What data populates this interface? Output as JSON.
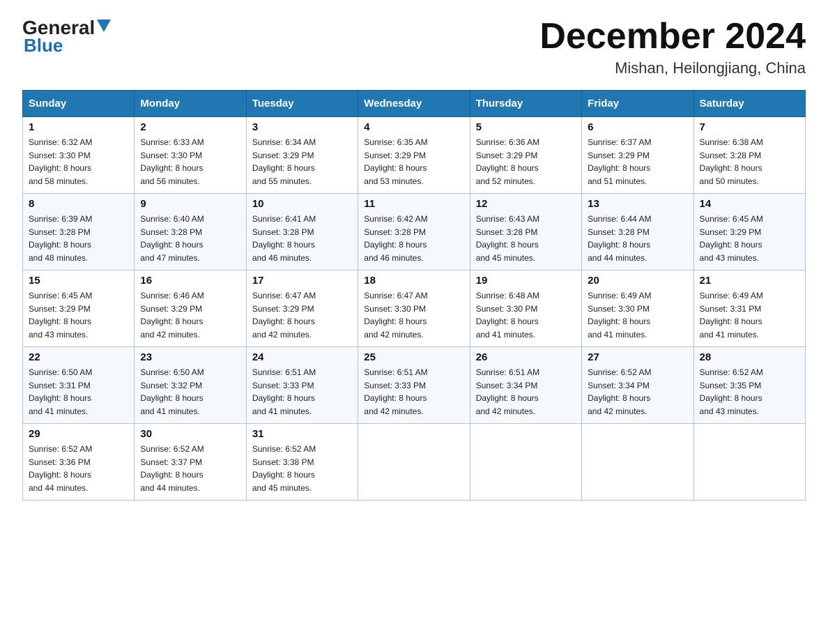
{
  "header": {
    "logo_general": "General",
    "logo_blue": "Blue",
    "month_title": "December 2024",
    "location": "Mishan, Heilongjiang, China"
  },
  "days_of_week": [
    "Sunday",
    "Monday",
    "Tuesday",
    "Wednesday",
    "Thursday",
    "Friday",
    "Saturday"
  ],
  "weeks": [
    [
      {
        "day": "1",
        "sunrise": "6:32 AM",
        "sunset": "3:30 PM",
        "daylight": "8 hours and 58 minutes."
      },
      {
        "day": "2",
        "sunrise": "6:33 AM",
        "sunset": "3:30 PM",
        "daylight": "8 hours and 56 minutes."
      },
      {
        "day": "3",
        "sunrise": "6:34 AM",
        "sunset": "3:29 PM",
        "daylight": "8 hours and 55 minutes."
      },
      {
        "day": "4",
        "sunrise": "6:35 AM",
        "sunset": "3:29 PM",
        "daylight": "8 hours and 53 minutes."
      },
      {
        "day": "5",
        "sunrise": "6:36 AM",
        "sunset": "3:29 PM",
        "daylight": "8 hours and 52 minutes."
      },
      {
        "day": "6",
        "sunrise": "6:37 AM",
        "sunset": "3:29 PM",
        "daylight": "8 hours and 51 minutes."
      },
      {
        "day": "7",
        "sunrise": "6:38 AM",
        "sunset": "3:28 PM",
        "daylight": "8 hours and 50 minutes."
      }
    ],
    [
      {
        "day": "8",
        "sunrise": "6:39 AM",
        "sunset": "3:28 PM",
        "daylight": "8 hours and 48 minutes."
      },
      {
        "day": "9",
        "sunrise": "6:40 AM",
        "sunset": "3:28 PM",
        "daylight": "8 hours and 47 minutes."
      },
      {
        "day": "10",
        "sunrise": "6:41 AM",
        "sunset": "3:28 PM",
        "daylight": "8 hours and 46 minutes."
      },
      {
        "day": "11",
        "sunrise": "6:42 AM",
        "sunset": "3:28 PM",
        "daylight": "8 hours and 46 minutes."
      },
      {
        "day": "12",
        "sunrise": "6:43 AM",
        "sunset": "3:28 PM",
        "daylight": "8 hours and 45 minutes."
      },
      {
        "day": "13",
        "sunrise": "6:44 AM",
        "sunset": "3:28 PM",
        "daylight": "8 hours and 44 minutes."
      },
      {
        "day": "14",
        "sunrise": "6:45 AM",
        "sunset": "3:29 PM",
        "daylight": "8 hours and 43 minutes."
      }
    ],
    [
      {
        "day": "15",
        "sunrise": "6:45 AM",
        "sunset": "3:29 PM",
        "daylight": "8 hours and 43 minutes."
      },
      {
        "day": "16",
        "sunrise": "6:46 AM",
        "sunset": "3:29 PM",
        "daylight": "8 hours and 42 minutes."
      },
      {
        "day": "17",
        "sunrise": "6:47 AM",
        "sunset": "3:29 PM",
        "daylight": "8 hours and 42 minutes."
      },
      {
        "day": "18",
        "sunrise": "6:47 AM",
        "sunset": "3:30 PM",
        "daylight": "8 hours and 42 minutes."
      },
      {
        "day": "19",
        "sunrise": "6:48 AM",
        "sunset": "3:30 PM",
        "daylight": "8 hours and 41 minutes."
      },
      {
        "day": "20",
        "sunrise": "6:49 AM",
        "sunset": "3:30 PM",
        "daylight": "8 hours and 41 minutes."
      },
      {
        "day": "21",
        "sunrise": "6:49 AM",
        "sunset": "3:31 PM",
        "daylight": "8 hours and 41 minutes."
      }
    ],
    [
      {
        "day": "22",
        "sunrise": "6:50 AM",
        "sunset": "3:31 PM",
        "daylight": "8 hours and 41 minutes."
      },
      {
        "day": "23",
        "sunrise": "6:50 AM",
        "sunset": "3:32 PM",
        "daylight": "8 hours and 41 minutes."
      },
      {
        "day": "24",
        "sunrise": "6:51 AM",
        "sunset": "3:33 PM",
        "daylight": "8 hours and 41 minutes."
      },
      {
        "day": "25",
        "sunrise": "6:51 AM",
        "sunset": "3:33 PM",
        "daylight": "8 hours and 42 minutes."
      },
      {
        "day": "26",
        "sunrise": "6:51 AM",
        "sunset": "3:34 PM",
        "daylight": "8 hours and 42 minutes."
      },
      {
        "day": "27",
        "sunrise": "6:52 AM",
        "sunset": "3:34 PM",
        "daylight": "8 hours and 42 minutes."
      },
      {
        "day": "28",
        "sunrise": "6:52 AM",
        "sunset": "3:35 PM",
        "daylight": "8 hours and 43 minutes."
      }
    ],
    [
      {
        "day": "29",
        "sunrise": "6:52 AM",
        "sunset": "3:36 PM",
        "daylight": "8 hours and 44 minutes."
      },
      {
        "day": "30",
        "sunrise": "6:52 AM",
        "sunset": "3:37 PM",
        "daylight": "8 hours and 44 minutes."
      },
      {
        "day": "31",
        "sunrise": "6:52 AM",
        "sunset": "3:38 PM",
        "daylight": "8 hours and 45 minutes."
      },
      null,
      null,
      null,
      null
    ]
  ],
  "labels": {
    "sunrise": "Sunrise:",
    "sunset": "Sunset:",
    "daylight": "Daylight:"
  }
}
